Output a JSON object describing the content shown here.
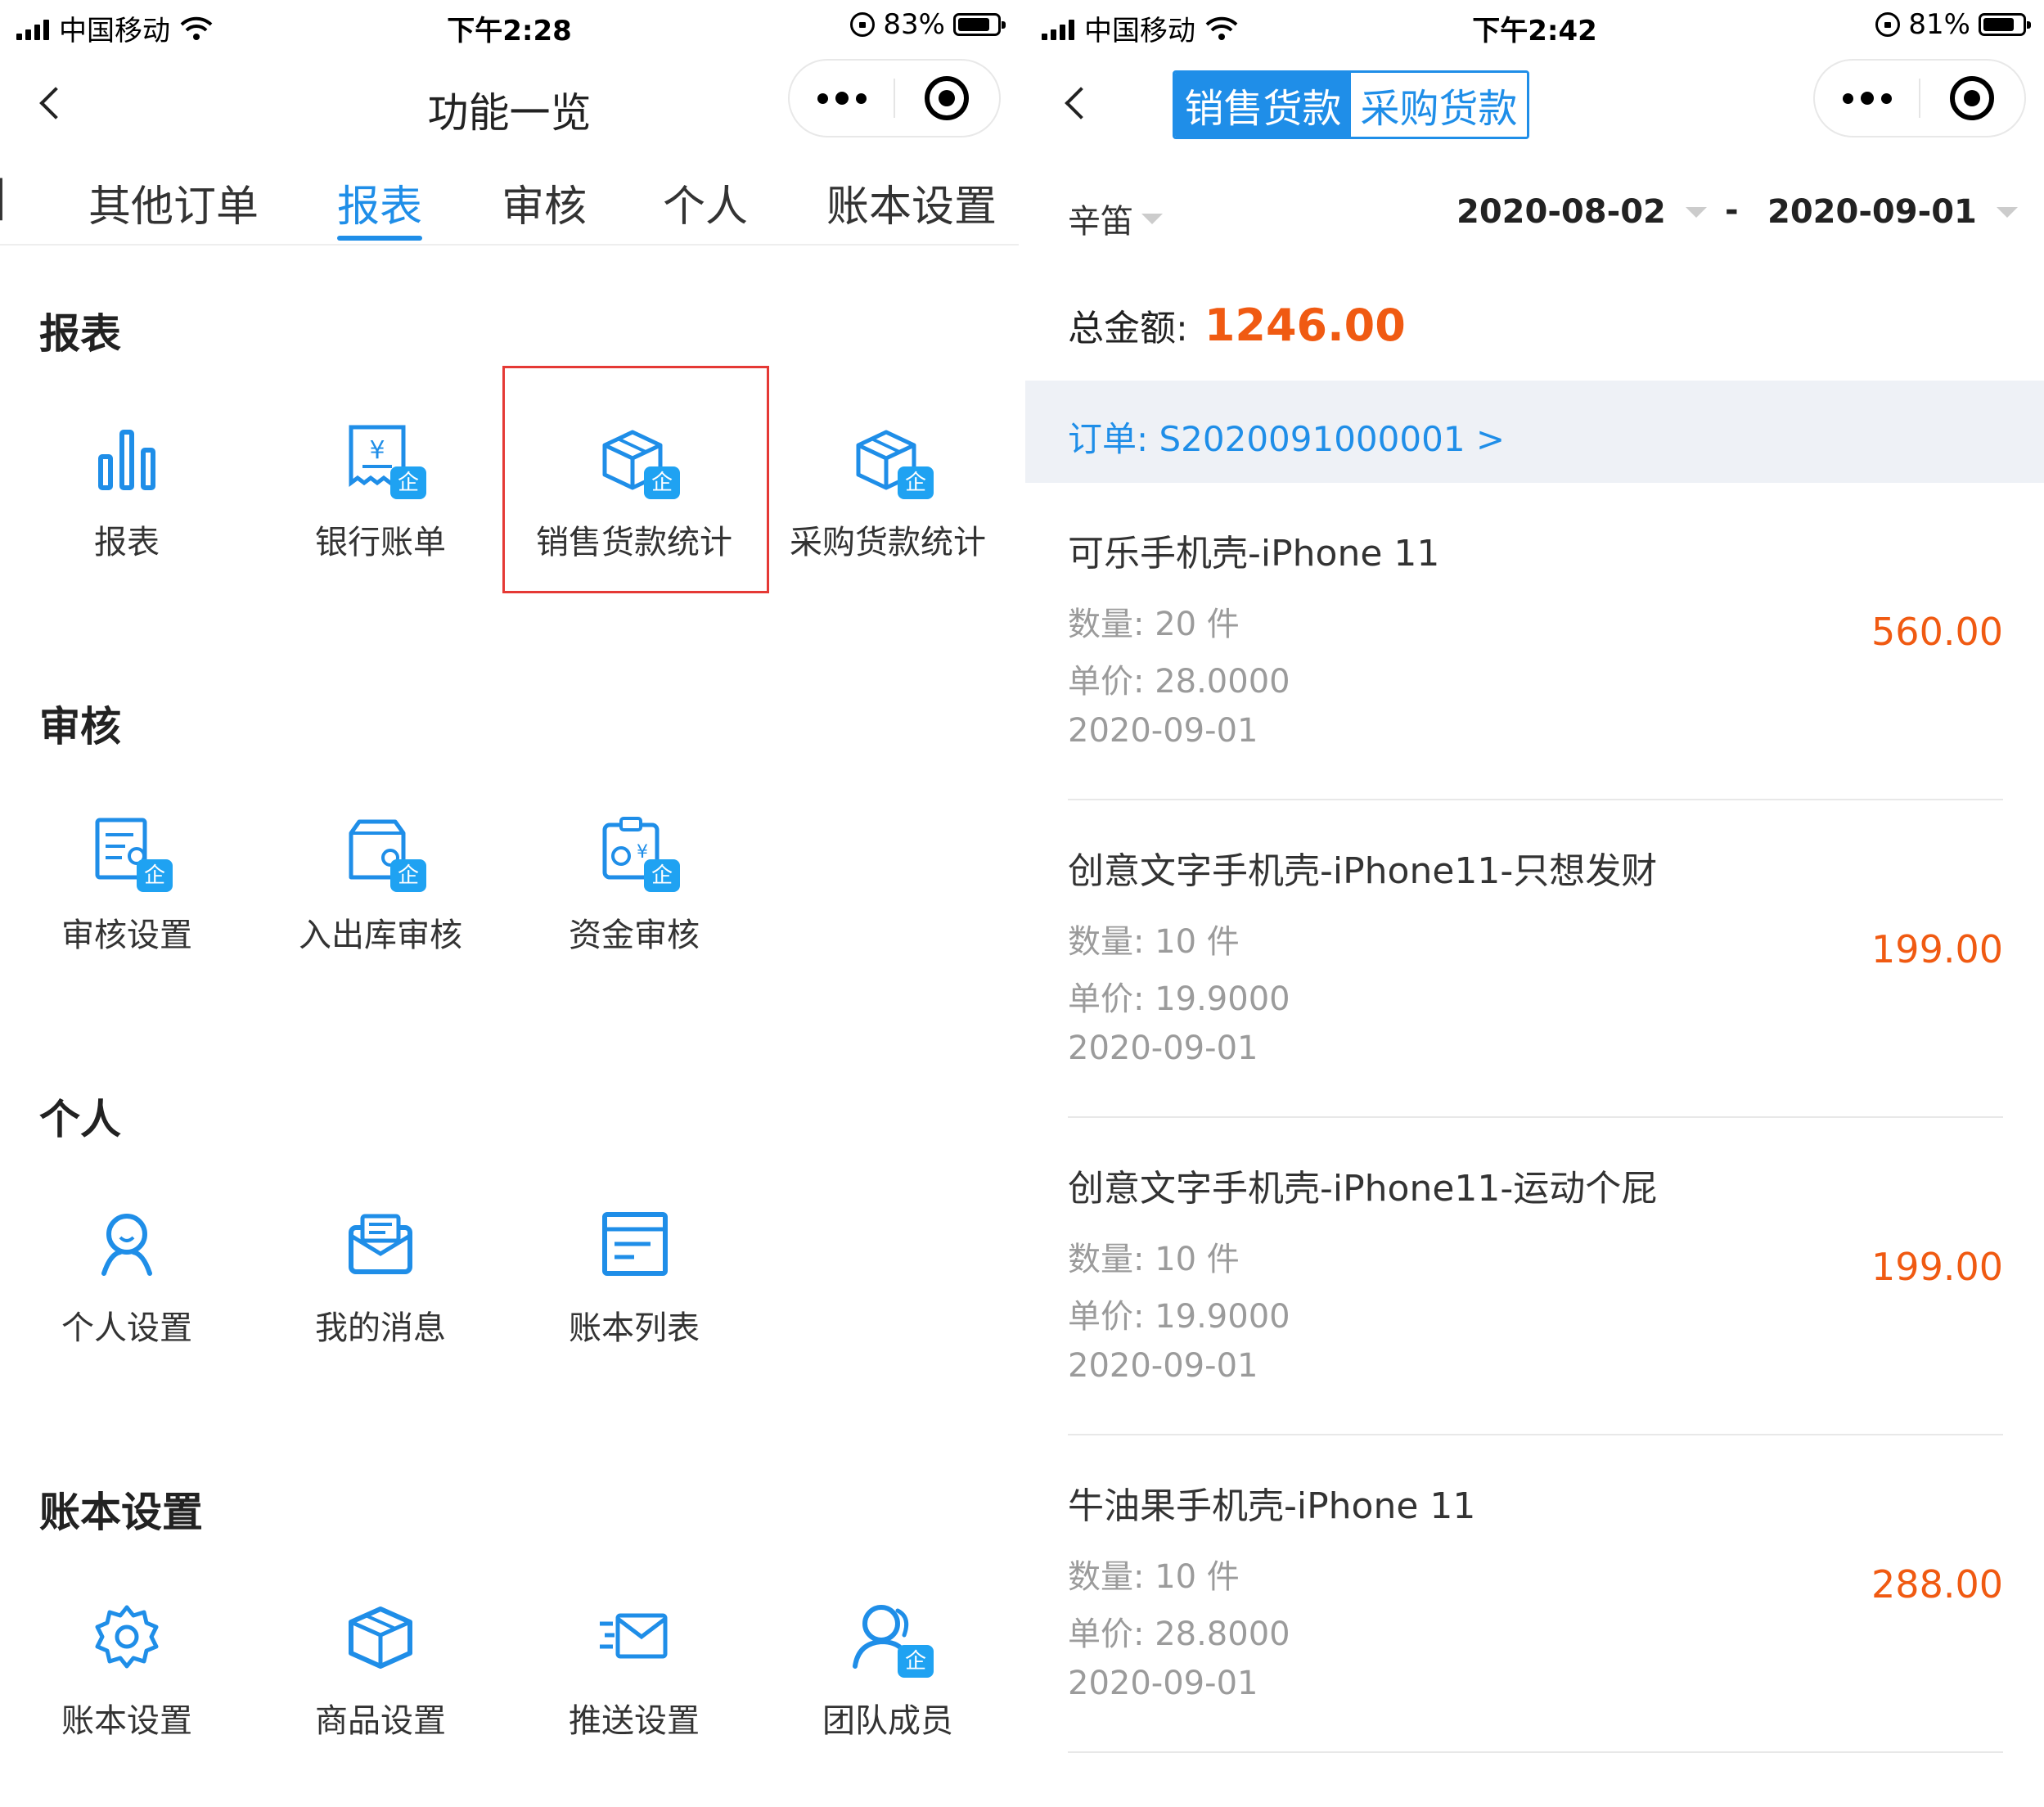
{
  "left": {
    "status": {
      "carrier": "中国移动",
      "time": "下午2:28",
      "battery_text": "83%",
      "battery_level": 0.83
    },
    "nav": {
      "title": "功能一览"
    },
    "tabs": [
      {
        "label": "其他订单",
        "active": false
      },
      {
        "label": "报表",
        "active": true
      },
      {
        "label": "审核",
        "active": false
      },
      {
        "label": "个人",
        "active": false
      },
      {
        "label": "账本设置",
        "active": false
      }
    ],
    "tab_partial": "|",
    "sections": [
      {
        "title": "报表",
        "items": [
          {
            "label": "报表",
            "icon": "bar-chart-icon"
          },
          {
            "label": "银行账单",
            "icon": "bank-receipt-icon"
          },
          {
            "label": "销售货款统计",
            "icon": "box-icon"
          },
          {
            "label": "采购货款统计",
            "icon": "box-icon"
          }
        ]
      },
      {
        "title": "审核",
        "items": [
          {
            "label": "审核设置",
            "icon": "audit-settings-icon"
          },
          {
            "label": "入出库审核",
            "icon": "warehouse-audit-icon"
          },
          {
            "label": "资金审核",
            "icon": "fund-audit-icon"
          }
        ]
      },
      {
        "title": "个人",
        "items": [
          {
            "label": "个人设置",
            "icon": "user-icon"
          },
          {
            "label": "我的消息",
            "icon": "message-icon"
          },
          {
            "label": "账本列表",
            "icon": "ledger-list-icon"
          }
        ]
      },
      {
        "title": "账本设置",
        "items": [
          {
            "label": "账本设置",
            "icon": "gear-icon"
          },
          {
            "label": "商品设置",
            "icon": "product-box-icon"
          },
          {
            "label": "推送设置",
            "icon": "push-mail-icon"
          },
          {
            "label": "团队成员",
            "icon": "team-icon"
          }
        ]
      }
    ],
    "badge": "企"
  },
  "right": {
    "status": {
      "carrier": "中国移动",
      "time": "下午2:42",
      "battery_text": "81%",
      "battery_level": 0.81
    },
    "segment": {
      "active": "销售货款",
      "inactive": "采购货款"
    },
    "filter": {
      "person": "辛笛",
      "date_from": "2020-08-02",
      "separator": "-",
      "date_to": "2020-09-01"
    },
    "total": {
      "label": "总金额:",
      "amount": "1246.00"
    },
    "order": {
      "text": "订单: S2020091000001 >"
    },
    "items": [
      {
        "name": "可乐手机壳-iPhone 11",
        "qty": "数量: 20 件",
        "unit_price": "单价: 28.0000",
        "date": "2020-09-01",
        "amount": "560.00"
      },
      {
        "name": "创意文字手机壳-iPhone11-只想发财",
        "qty": "数量: 10 件",
        "unit_price": "单价: 19.9000",
        "date": "2020-09-01",
        "amount": "199.00"
      },
      {
        "name": "创意文字手机壳-iPhone11-运动个屁",
        "qty": "数量: 10 件",
        "unit_price": "单价: 19.9000",
        "date": "2020-09-01",
        "amount": "199.00"
      },
      {
        "name": "牛油果手机壳-iPhone 11",
        "qty": "数量: 10 件",
        "unit_price": "单价: 28.8000",
        "date": "2020-09-01",
        "amount": "288.00"
      }
    ]
  },
  "colors": {
    "accent": "#1f8ee8",
    "price": "#f05a12",
    "highlight": "#e53935",
    "badge": "#1fa2f2"
  }
}
